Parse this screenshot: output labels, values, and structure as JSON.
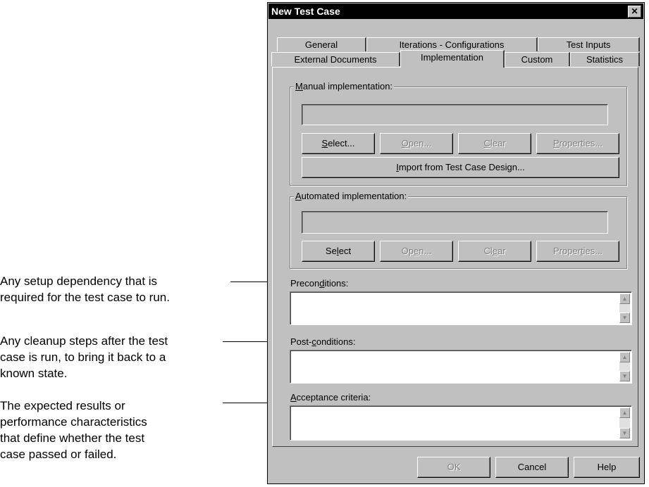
{
  "callouts": {
    "preconditions": "Any setup dependency that is\nrequired for the test case to run.",
    "postconditions": "Any cleanup steps after the test\ncase is run, to bring it back to a\nknown state.",
    "acceptance": "The expected results or\nperformance characteristics\nthat define whether the test\ncase passed or failed."
  },
  "dialog": {
    "title": "New Test Case",
    "close_glyph": "✕",
    "tabs_row1": [
      "General",
      "Iterations - Configurations",
      "Test Inputs"
    ],
    "tabs_row2": [
      "External Documents",
      "Implementation",
      "Custom",
      "Statistics"
    ],
    "active_tab": "Implementation",
    "manual": {
      "label_u": "M",
      "label_rest": "anual implementation:",
      "value": "",
      "select_u": "S",
      "select_rest": "elect...",
      "open_u": "O",
      "open_rest": "pen...",
      "clear_u": "C",
      "clear_rest": "lear",
      "properties_u": "P",
      "properties_rest": "roperties...",
      "import_pre": "",
      "import_u": "I",
      "import_rest": "mport from Test Case Design..."
    },
    "automated": {
      "label_u": "A",
      "label_rest": "utomated implementation:",
      "value": "",
      "select_pre": "Se",
      "select_u": "l",
      "select_rest": "ect",
      "open_pre": "Op",
      "open_u": "e",
      "open_rest": "n...",
      "clear_pre": "Cl",
      "clear_u": "e",
      "clear_rest": "ar",
      "properties_pre": "Proper",
      "properties_u": "t",
      "properties_rest": "ies..."
    },
    "preconditions": {
      "pre": "Precon",
      "u": "d",
      "rest": "itions:"
    },
    "postconditions": {
      "pre": "Post-",
      "u": "c",
      "rest": "onditions:"
    },
    "acceptance": {
      "pre": "",
      "u": "A",
      "rest": "cceptance criteria:"
    },
    "scroll_up": "▲",
    "scroll_down": "▼",
    "buttons": {
      "ok": "OK",
      "cancel": "Cancel",
      "help": "Help"
    }
  }
}
